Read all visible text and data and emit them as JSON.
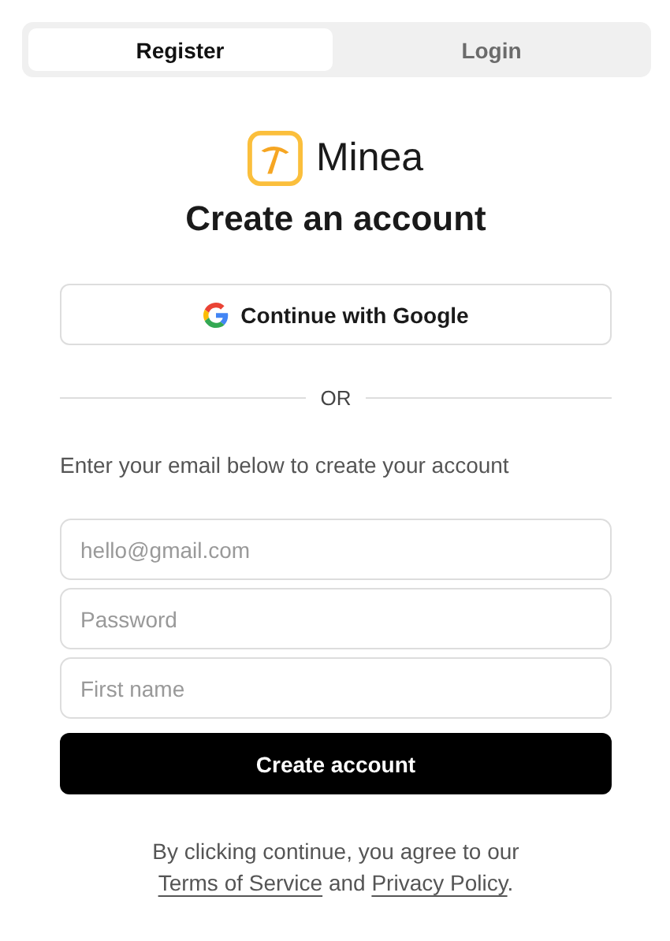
{
  "tabs": [
    {
      "label": "Register",
      "selected": true
    },
    {
      "label": "Login",
      "selected": false
    }
  ],
  "brand": {
    "name": "Minea"
  },
  "heading": "Create an account",
  "google_button": {
    "label": "Continue with Google"
  },
  "divider": {
    "label": "OR"
  },
  "instruction": "Enter your email below to create your account",
  "fields": [
    {
      "placeholder": "hello@gmail.com"
    },
    {
      "placeholder": "Password"
    },
    {
      "placeholder": "First name"
    }
  ],
  "submit_button": {
    "label": "Create account"
  },
  "legal": {
    "text_before": "By clicking continue, you agree to our",
    "link_1": "Terms of Service",
    "text_between": "and",
    "link_2": "Privacy Policy",
    "text_after": "."
  }
}
